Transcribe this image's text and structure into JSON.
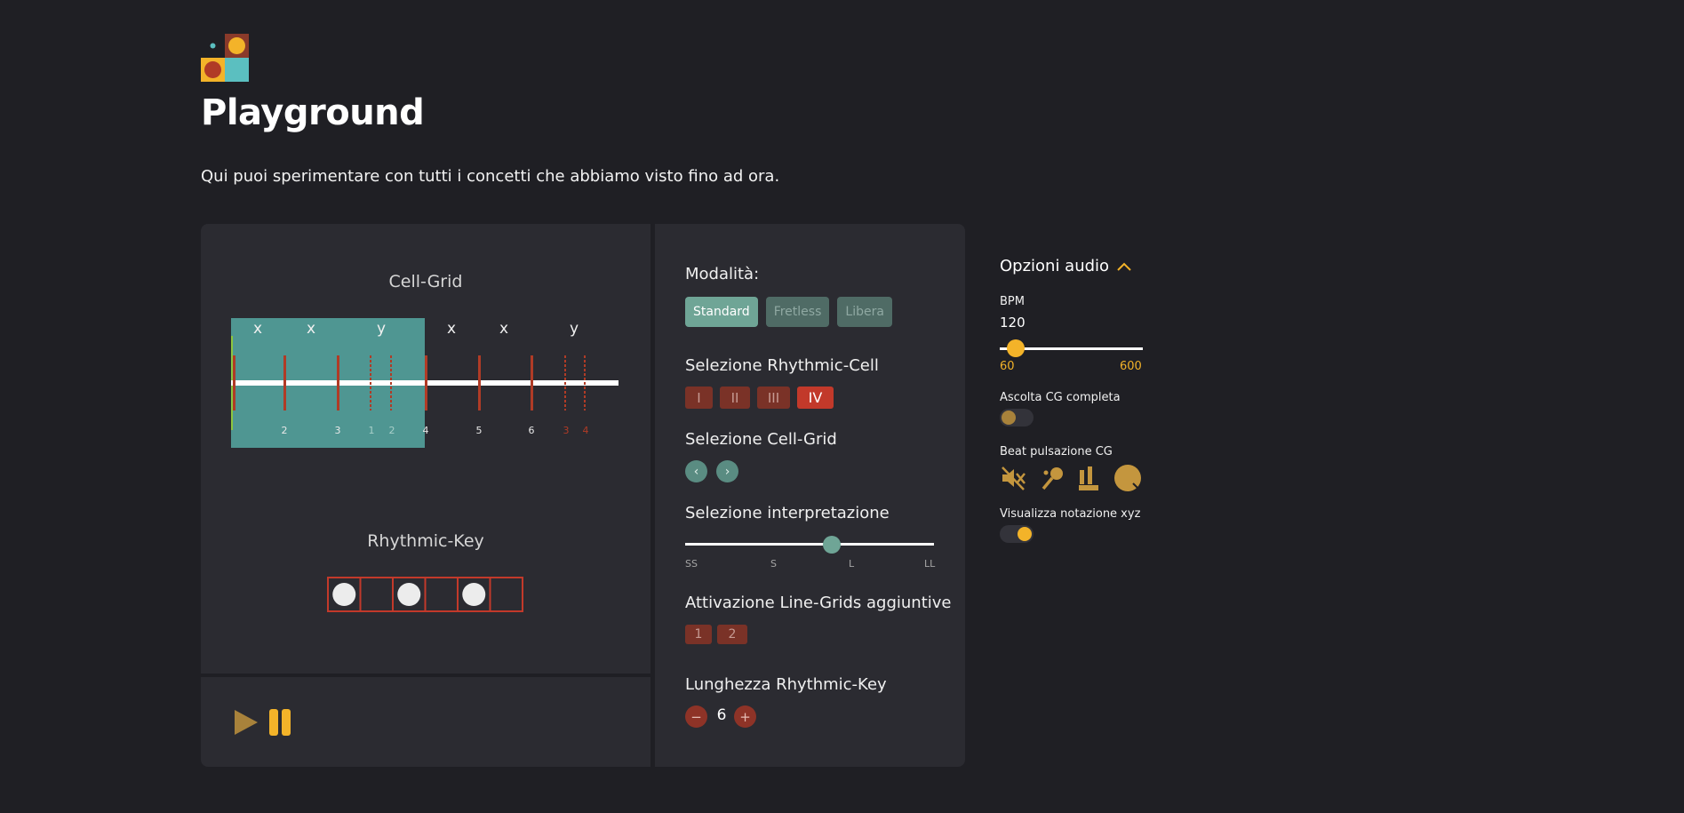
{
  "page": {
    "title": "Playground",
    "subtitle": "Qui puoi sperimentare con tutti i concetti che abbiamo visto fino ad ora."
  },
  "cell_grid": {
    "title": "Cell-Grid",
    "labels": [
      "x",
      "x",
      "y",
      "x",
      "x",
      "y"
    ],
    "numbers": [
      "2",
      "3",
      "1",
      "2",
      "4",
      "5",
      "6",
      "3",
      "4"
    ]
  },
  "rhythmic_key": {
    "title": "Rhythmic-Key",
    "cells": [
      true,
      false,
      true,
      false,
      true,
      false
    ]
  },
  "player": {
    "play_icon": "play-icon",
    "pause_icon": "pause-icon"
  },
  "controls": {
    "mode_label": "Modalità:",
    "modes": [
      "Standard",
      "Fretless",
      "Libera"
    ],
    "active_mode": "Standard",
    "rhythmic_cell_label": "Selezione Rhythmic-Cell",
    "rhythmic_cells": [
      "I",
      "II",
      "III",
      "IV"
    ],
    "active_rhythmic_cell": "IV",
    "cell_grid_label": "Selezione Cell-Grid",
    "interpretation_label": "Selezione interpretazione",
    "interpretation_ticks": [
      "SS",
      "S",
      "L",
      "LL"
    ],
    "interpretation_value": 0.59,
    "line_grids_label": "Attivazione Line-Grids aggiuntive",
    "line_grids": [
      "1",
      "2"
    ],
    "rk_length_label": "Lunghezza Rhythmic-Key",
    "rk_length": "6",
    "minus": "−",
    "plus": "+"
  },
  "audio": {
    "title": "Opzioni audio",
    "bpm_label": "BPM",
    "bpm_value": "120",
    "bpm_min": "60",
    "bpm_max": "600",
    "bpm_fraction": 0.111,
    "listen_label": "Ascolta CG completa",
    "listen_on": false,
    "beat_label": "Beat pulsazione CG",
    "beat_icons": [
      "mute-icon",
      "maracas-icon",
      "metronome-icon",
      "drum-icon"
    ],
    "xyz_label": "Visualizza notazione xyz",
    "xyz_on": true
  },
  "colors": {
    "accent_yellow": "#f3b329",
    "teal": "#4f9692",
    "red": "#c2392a"
  }
}
